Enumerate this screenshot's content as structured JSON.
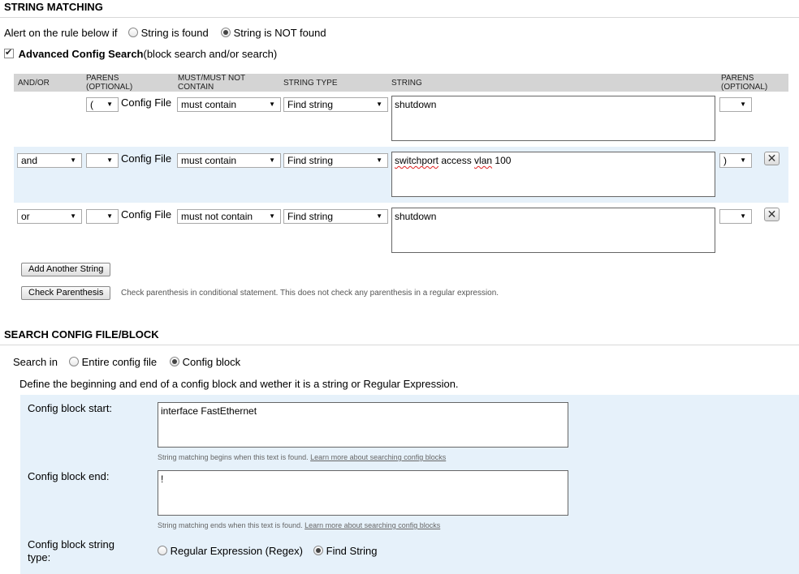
{
  "string_matching": {
    "title": "STRING MATCHING",
    "alert_label": "Alert on the rule below if",
    "option_found": "String is found",
    "option_not_found": "String is NOT found",
    "selected": "not_found",
    "advanced_checked": true,
    "advanced_label": "Advanced Config Search",
    "advanced_suffix": "(block search and/or search)",
    "headers": {
      "andor": "AND/OR",
      "parens1": "PARENS",
      "parens1_sub": "(OPTIONAL)",
      "must1": "MUST/MUST NOT",
      "must2": "CONTAIN",
      "type": "STRING TYPE",
      "string": "STRING",
      "parens2": "PARENS",
      "parens2_sub": "(OPTIONAL)"
    },
    "rows": [
      {
        "andor": "",
        "open_paren": "(",
        "source": "Config File",
        "must": "must contain",
        "type": "Find string",
        "string": "shutdown",
        "close_paren": ""
      },
      {
        "andor": "and",
        "open_paren": "",
        "source": "Config File",
        "must": "must contain",
        "type": "Find string",
        "string_a": "switchport",
        "string_b": " access ",
        "string_c": "vlan",
        "string_d": " 100",
        "close_paren": ")"
      },
      {
        "andor": "or",
        "open_paren": "",
        "source": "Config File",
        "must": "must not contain",
        "type": "Find string",
        "string": "shutdown",
        "close_paren": ""
      }
    ],
    "remove_glyph": "✕",
    "add_button": "Add Another String",
    "check_button": "Check Parenthesis",
    "check_note": "Check parenthesis in conditional statement. This does not check any parenthesis in a regular expression."
  },
  "search_config": {
    "title": "SEARCH CONFIG FILE/BLOCK",
    "search_in_label": "Search in",
    "option_entire": "Entire config file",
    "option_block": "Config block",
    "selected": "block",
    "define_text": "Define the beginning and end of a config block and wether it is a string or Regular Expression.",
    "start_label": "Config block start:",
    "start_value": "interface FastEthernet",
    "start_note": "String matching begins when this text is found.",
    "end_label": "Config block end:",
    "end_value": "!",
    "end_note": "String matching ends when this text is found.",
    "learn_link": "Learn more about searching config blocks",
    "type_label_1": "Config block string",
    "type_label_2": "type:",
    "option_regex": "Regular Expression (Regex)",
    "option_find": "Find String",
    "type_selected": "find"
  },
  "icons": {
    "dropdown": "triangle-down-icon",
    "remove": "close-icon",
    "check": "checkmark-icon"
  }
}
